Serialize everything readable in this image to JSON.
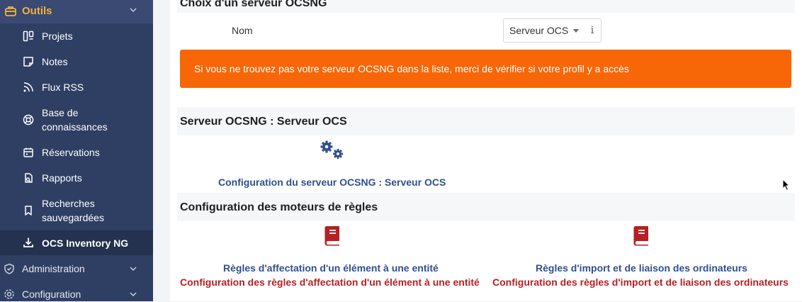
{
  "sidebar": {
    "section": "Outils",
    "items": [
      {
        "label": "Projets",
        "icon": "projects-icon"
      },
      {
        "label": "Notes",
        "icon": "notes-icon"
      },
      {
        "label": "Flux RSS",
        "icon": "rss-icon"
      },
      {
        "label": "Base de\nconnaissances",
        "label1": "Base de",
        "label2": "connaissances",
        "icon": "lifebuoy-icon"
      },
      {
        "label": "Réservations",
        "icon": "calendar-icon"
      },
      {
        "label": "Rapports",
        "icon": "report-icon"
      },
      {
        "label": "Recherches\nsauvegardées",
        "label1": "Recherches",
        "label2": "sauvegardées",
        "icon": "bookmark-icon"
      },
      {
        "label": "OCS Inventory NG",
        "icon": "download-icon"
      }
    ],
    "administration": "Administration",
    "configuration": "Configuration"
  },
  "main": {
    "top_heading": "Choix d'un serveur OCSNG",
    "nom_label": "Nom",
    "server_select": "Serveur OCS",
    "info_button": "i",
    "alert": "Si vous ne trouvez pas votre serveur OCSNG dans la liste, merci de vérifier si votre profil y a accès",
    "server_heading": "Serveur OCSNG : Serveur OCS",
    "server_config_link": "Configuration du serveur OCSNG : Serveur OCS",
    "rules_heading": "Configuration des moteurs de règles",
    "rule1_title": "Règles d'affectation d'un élément à une entité",
    "rule1_subtitle": "Configuration des règles d'affectation d'un élément à une entité",
    "rule2_title": "Règles d'import et de liaison des ordinateurs",
    "rule2_subtitle": "Configuration des règles d'import et de liaison des ordinateurs"
  },
  "colors": {
    "sidebar": "#2f3f64",
    "accent": "#f4b03e",
    "alert": "#f76707",
    "link_blue": "#2f4f8f",
    "link_red": "#b62024"
  }
}
